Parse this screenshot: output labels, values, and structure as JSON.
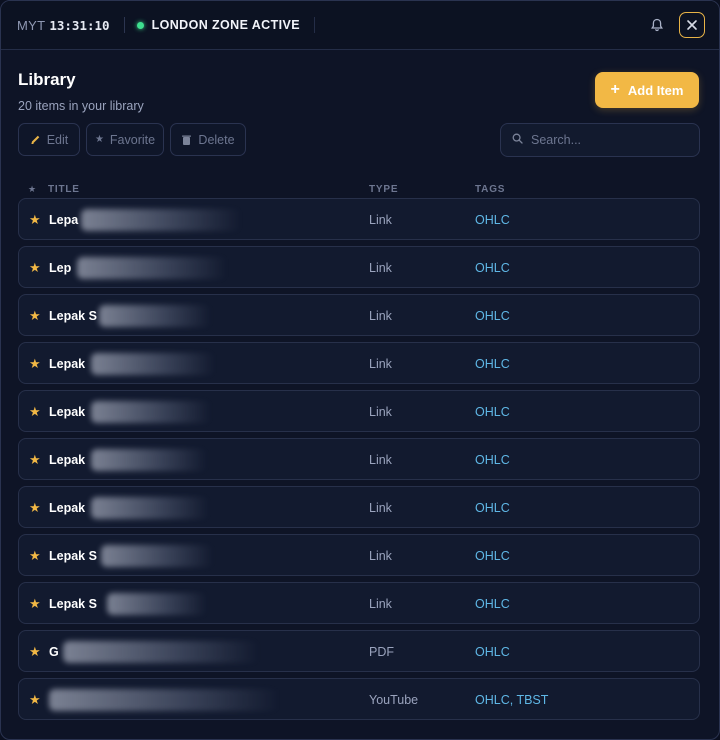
{
  "topbar": {
    "timezone": "MYT",
    "clock": "13:31:10",
    "zone_status": "LONDON ZONE ACTIVE",
    "icons": {
      "bell": "bell-icon",
      "close": "close-icon"
    }
  },
  "header": {
    "title": "Library",
    "subtitle": "20 items in your library",
    "add_label": "Add Item"
  },
  "toolbar": {
    "edit_label": "Edit",
    "favorite_label": "Favorite",
    "delete_label": "Delete",
    "search_placeholder": "Search..."
  },
  "table": {
    "columns": {
      "title": "TITLE",
      "type": "TYPE",
      "tags": "TAGS"
    },
    "rows": [
      {
        "title": "Lepa",
        "type": "Link",
        "tags": "OHLC"
      },
      {
        "title": "Lep",
        "type": "Link",
        "tags": "OHLC"
      },
      {
        "title": "Lepak S",
        "type": "Link",
        "tags": "OHLC"
      },
      {
        "title": "Lepak",
        "type": "Link",
        "tags": "OHLC"
      },
      {
        "title": "Lepak",
        "type": "Link",
        "tags": "OHLC"
      },
      {
        "title": "Lepak",
        "type": "Link",
        "tags": "OHLC"
      },
      {
        "title": "Lepak",
        "type": "Link",
        "tags": "OHLC"
      },
      {
        "title": "Lepak S",
        "type": "Link",
        "tags": "OHLC"
      },
      {
        "title": "Lepak S",
        "type": "Link",
        "tags": "OHLC"
      },
      {
        "title": "G",
        "type": "PDF",
        "tags": "OHLC"
      },
      {
        "title": "",
        "type": "YouTube",
        "tags": "OHLC, TBST"
      }
    ]
  },
  "colors": {
    "accent": "#f2b845",
    "tag": "#5fb7e6",
    "status_dot": "#3ee08f",
    "background": "#0e1426"
  }
}
